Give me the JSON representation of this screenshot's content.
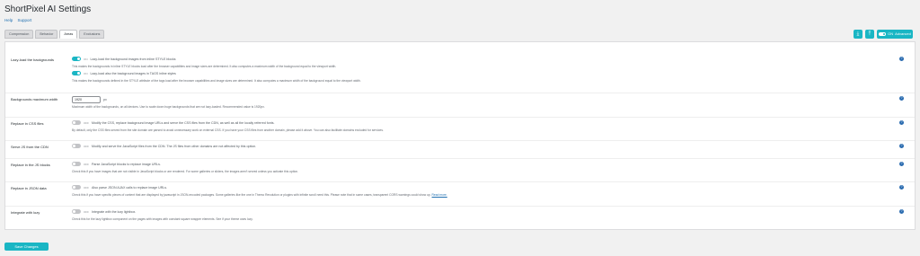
{
  "header": {
    "title": "ShortPixel AI Settings",
    "links": [
      "Help",
      "Support"
    ]
  },
  "tabs": [
    {
      "label": "Compression",
      "active": false
    },
    {
      "label": "Behavior",
      "active": false
    },
    {
      "label": "Areas",
      "active": true
    },
    {
      "label": "Exclusions",
      "active": false
    }
  ],
  "toolbar": {
    "download_icon": "download-icon",
    "upload_icon": "upload-icon",
    "advanced_label": "Advanced",
    "advanced_state": "ON"
  },
  "rows": [
    {
      "label": "Lazy-load the backgrounds",
      "toggle_state": "ON",
      "options": [
        {
          "state": "ON",
          "text": "Lazy-load the background images from inline STYLE blocks",
          "desc": "This makes the backgrounds in inline STYLE blocks load after the browser capabilities and image sizes are determined. It also computes a maximum width of the background equal to the viewport width."
        },
        {
          "state": "ON",
          "text": "Lazy-load also the background images in TAGS inline styles",
          "desc": "This makes the backgrounds defined in the STYLE attribute of the tags load after the browser capabilities and image sizes are determined. It also computes a maximum width of the background equal to the viewport width."
        }
      ]
    },
    {
      "label": "Backgrounds maximum width",
      "value": "1920",
      "unit": "px",
      "desc": "Maximum width of the backgrounds, on all devices. Use to scale down huge backgrounds that are not lazy-loaded. Recommended value is 1920px."
    },
    {
      "label": "Replace in CSS files",
      "toggle_state": "OFF",
      "text": "Modify the CSS, replace background image URLs and serve the CSS files from the CDN, as well as all the locally referred fonts.",
      "desc": "By default, only the CSS files served from the site domain are parsed to avoid unnecessary work on external CSS. If you have your CSS files from another domain, please add it above. You can also facilitate domains excluded for services."
    },
    {
      "label": "Serve JS from the CDN",
      "toggle_state": "OFF",
      "text": "Modify and serve the JavaScript files from the CDN. The JS files from other domains are not affected by this option."
    },
    {
      "label": "Replace in the JS blocks",
      "toggle_state": "OFF",
      "text": "Parse JavaScript blocks to replace image URLs.",
      "desc": "Check this if you have images that are not visible in JavaScript blocks or are rendered. For some galleries or sliders, the images aren't served unless you activate this option."
    },
    {
      "label": "Replace in JSON data",
      "toggle_state": "OFF",
      "text": "Also parse JSON AJAX calls to replace image URLs.",
      "desc": "Check this if you have specific pieces of content that are displayed by javascript in JSON-encoded packages. Some galleries like the one in Themo Revolution or plugins with infinite scroll need this. Please note that in some cases, transparent CORS warnings could show up.",
      "read_more": "Read more."
    },
    {
      "label": "Integrate with lozy",
      "toggle_state": "OFF",
      "text": "Integrate with the lozy lightbox.",
      "desc": "Check this for the lazy lightbox component on the pages with images with constant square wrapper elements. See if your theme uses lozy."
    }
  ],
  "save_label": "Save Changes",
  "colors": {
    "accent": "#1ab6c4",
    "link": "#2271b1",
    "help": "#2b6cb0"
  }
}
